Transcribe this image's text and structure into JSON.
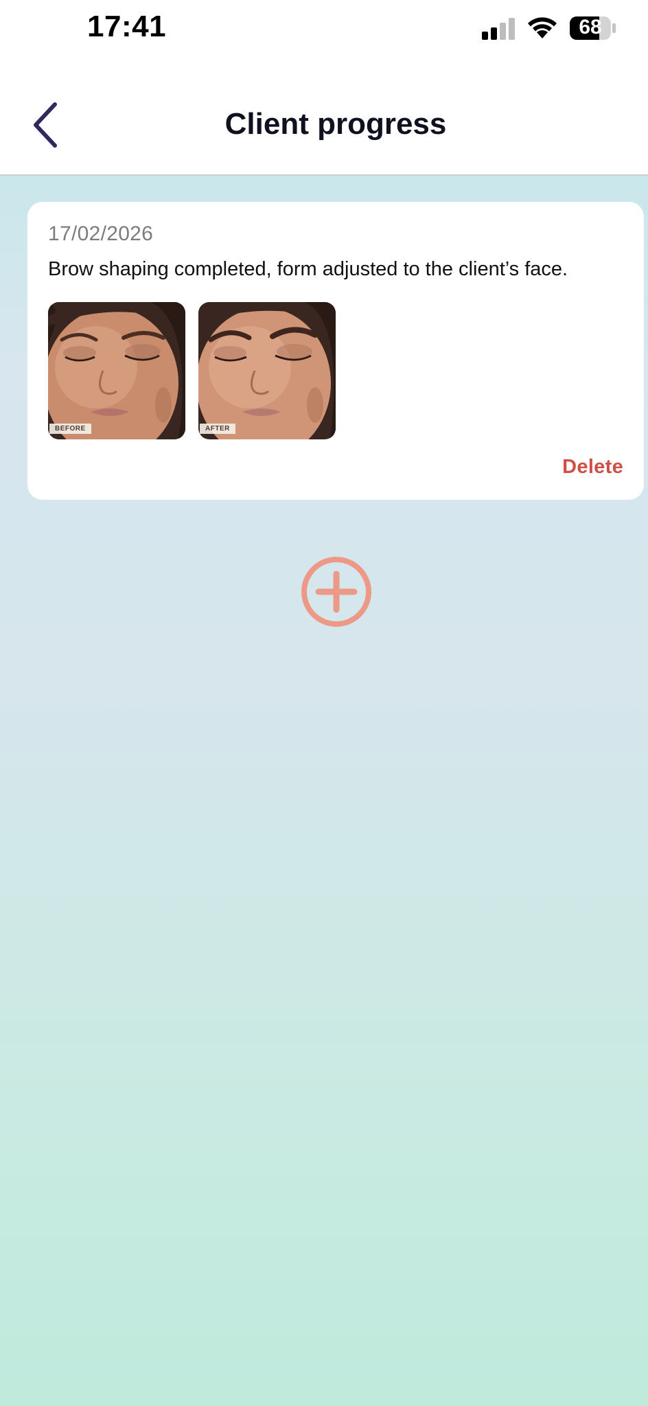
{
  "status_bar": {
    "time": "17:41",
    "battery_level": "68",
    "signal_icon": "cellular-signal-icon",
    "wifi_icon": "wifi-icon",
    "battery_icon": "battery-icon"
  },
  "header": {
    "title": "Client progress",
    "back_icon": "chevron-left-icon"
  },
  "entries": [
    {
      "date": "17/02/2026",
      "note": "Brow shaping completed, form adjusted to the client’s face.",
      "photos": [
        {
          "label": "BEFORE"
        },
        {
          "label": "AFTER"
        }
      ],
      "delete_label": "Delete"
    }
  ],
  "add_button": {
    "icon": "plus-circle-icon"
  },
  "colors": {
    "accent": "#cf4f46",
    "add_icon": "#ec9a87",
    "back_icon": "#2f2a5e",
    "gradient_top": "#bde9e7",
    "gradient_bottom": "#bfeadc"
  }
}
